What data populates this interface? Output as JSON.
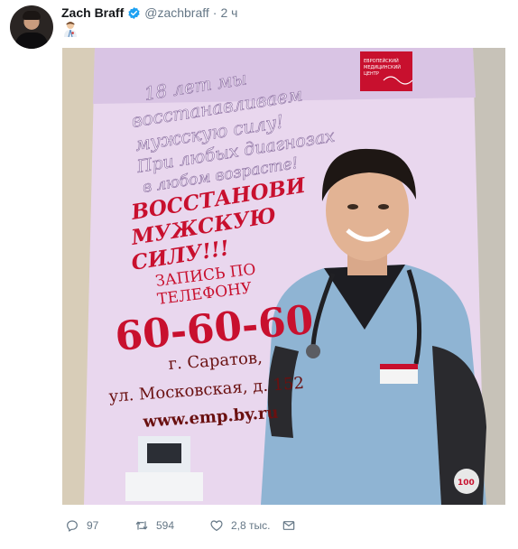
{
  "tweet": {
    "author_name": "Zach Braff",
    "handle": "@zachbraff",
    "separator": "·",
    "time": "2 ч",
    "body_emoji": "👨‍⚕️"
  },
  "poster": {
    "lines_top": [
      "18 лет мы",
      "восстанавливаем",
      "мужскую силу!",
      "При любых диагнозах",
      "в любом возрасте!"
    ],
    "headline": [
      "ВОССТАНОВИ",
      "МУЖСКУЮ",
      "СИЛУ!!!"
    ],
    "appointment": [
      "ЗАПИСЬ ПО",
      "ТЕЛЕФОНУ"
    ],
    "phone": "60-60-60",
    "city": "г. Саратов,",
    "street": "ул. Московская, д. 152",
    "website": "www.emp.by.ru",
    "corner_badge": "100"
  },
  "stats": {
    "replies": "97",
    "retweets": "594",
    "likes": "2,8 тыс."
  },
  "colors": {
    "accent_red": "#c8102e",
    "poster_pink": "#e8d6ec",
    "scrub_blue": "#8fb4d3",
    "meta_gray": "#657786",
    "verified_blue": "#1da1f2"
  }
}
